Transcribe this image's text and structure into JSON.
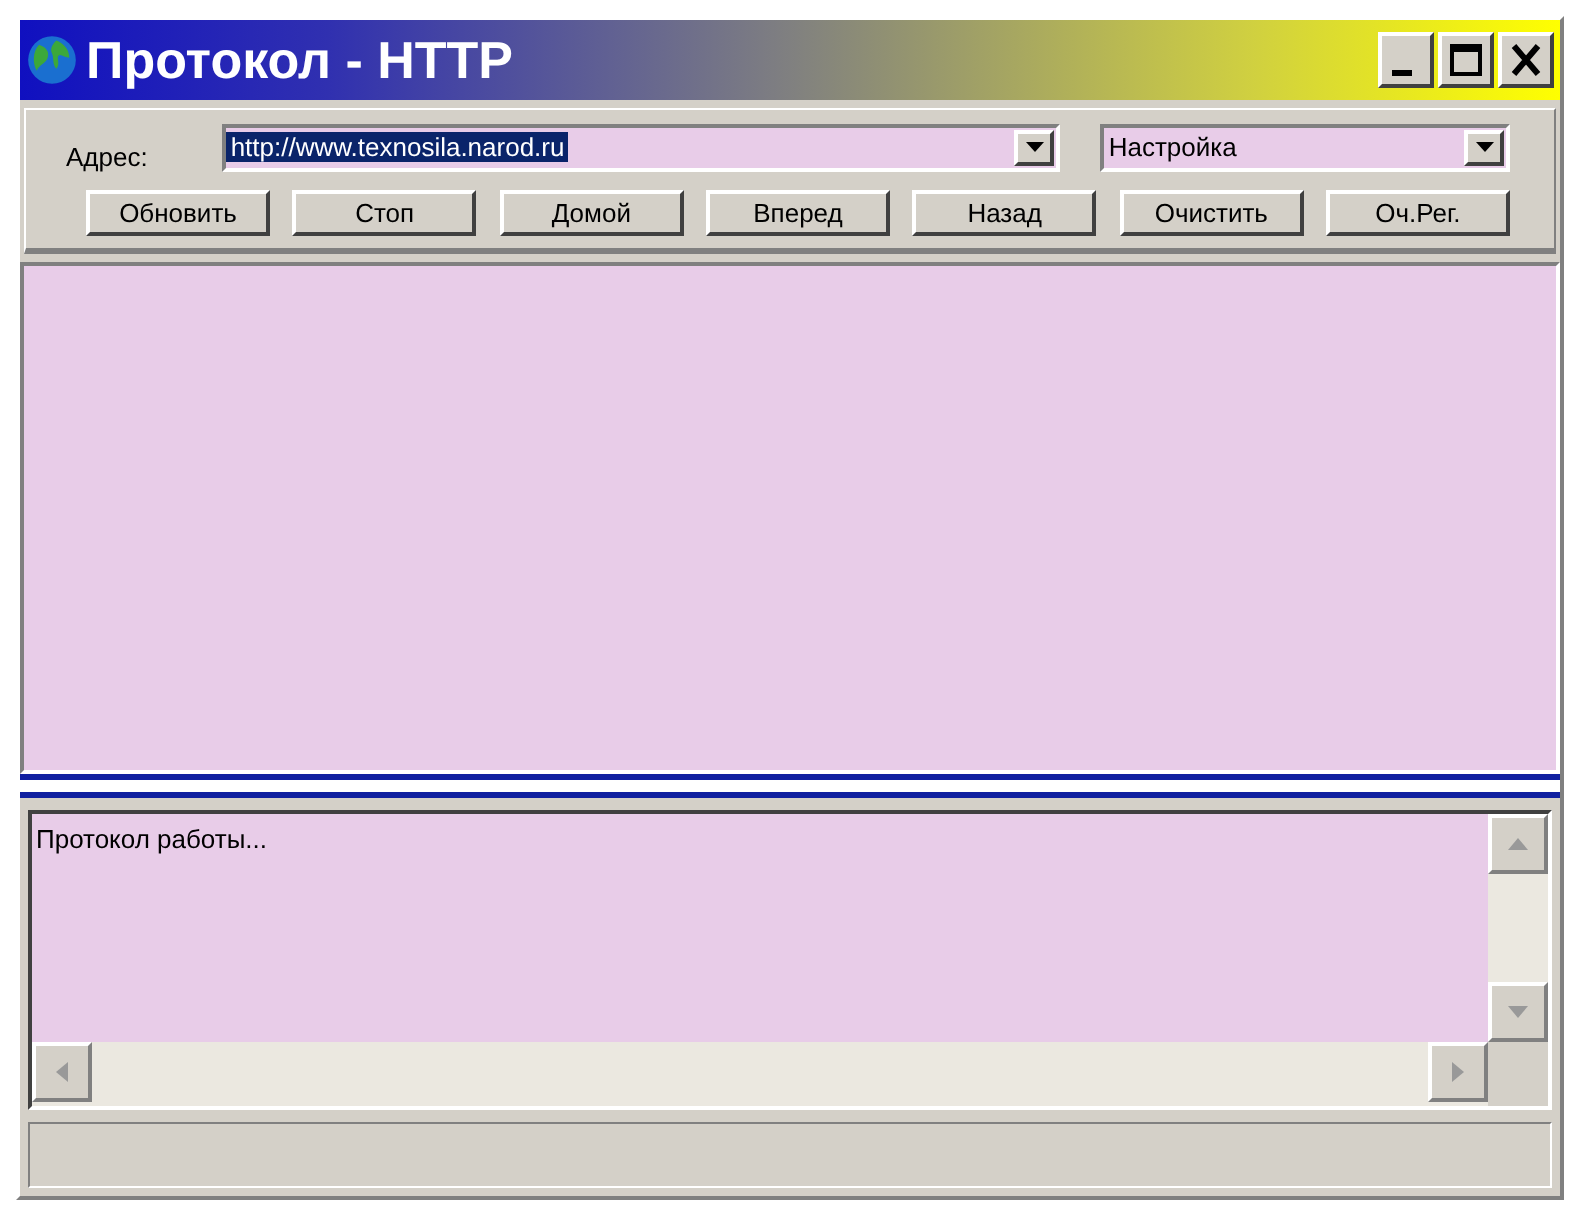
{
  "window": {
    "title": "Протокол - HTTP"
  },
  "address": {
    "label": "Адрес:",
    "value": "http://www.texnosila.narod.ru",
    "selected": true
  },
  "settings": {
    "value": "Настройка"
  },
  "buttons": [
    "Обновить",
    "Стоп",
    "Домой",
    "Вперед",
    "Назад",
    "Очистить",
    "Оч.Рег."
  ],
  "log": {
    "text": "Протокол работы..."
  }
}
